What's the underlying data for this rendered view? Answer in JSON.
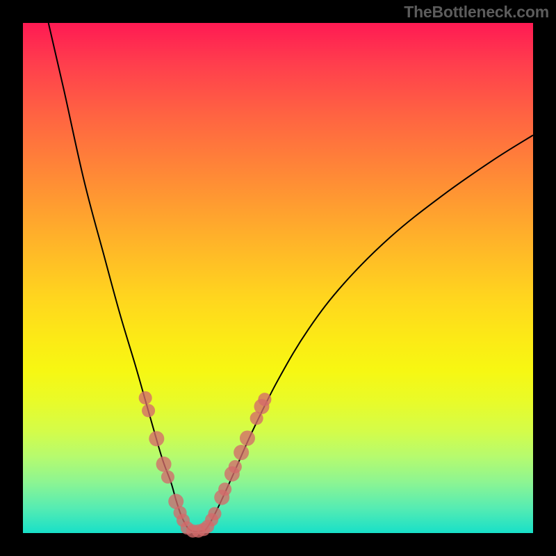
{
  "watermark": "TheBottleneck.com",
  "colors": {
    "dot": "#d46a6a",
    "curve": "#000000",
    "plot_top": "#ff1a53",
    "plot_bottom": "#18e0c8",
    "frame": "#000000"
  },
  "chart_data": {
    "type": "line",
    "title": "",
    "xlabel": "",
    "ylabel": "",
    "xlim": [
      0,
      100
    ],
    "ylim": [
      0,
      100
    ],
    "series": [
      {
        "name": "left-branch",
        "x": [
          5,
          8,
          12,
          16,
          19,
          22,
          24,
          26,
          27.5,
          29,
          30,
          31,
          31.8
        ],
        "y": [
          100,
          87,
          69,
          54,
          43,
          33,
          26,
          19,
          14,
          10,
          6.5,
          3.5,
          1.8
        ]
      },
      {
        "name": "valley",
        "x": [
          31.8,
          32.5,
          33.2,
          34,
          35,
          36
        ],
        "y": [
          1.8,
          0.8,
          0.4,
          0.25,
          0.4,
          0.9
        ]
      },
      {
        "name": "right-branch",
        "x": [
          36,
          38,
          41,
          45,
          50,
          56,
          63,
          72,
          82,
          92,
          100
        ],
        "y": [
          0.9,
          4.5,
          11,
          20,
          30,
          40,
          49,
          58,
          66,
          73,
          78
        ]
      }
    ],
    "dots": {
      "name": "highlight-dots",
      "points": [
        {
          "x": 24.0,
          "y": 26.5,
          "r": 1.3
        },
        {
          "x": 24.6,
          "y": 24.0,
          "r": 1.3
        },
        {
          "x": 26.2,
          "y": 18.5,
          "r": 1.5
        },
        {
          "x": 27.6,
          "y": 13.5,
          "r": 1.5
        },
        {
          "x": 28.4,
          "y": 11.0,
          "r": 1.3
        },
        {
          "x": 30.0,
          "y": 6.2,
          "r": 1.5
        },
        {
          "x": 30.8,
          "y": 4.0,
          "r": 1.3
        },
        {
          "x": 31.4,
          "y": 2.5,
          "r": 1.3
        },
        {
          "x": 32.2,
          "y": 1.0,
          "r": 1.3
        },
        {
          "x": 33.3,
          "y": 0.4,
          "r": 1.3
        },
        {
          "x": 34.4,
          "y": 0.4,
          "r": 1.3
        },
        {
          "x": 35.4,
          "y": 0.7,
          "r": 1.3
        },
        {
          "x": 36.2,
          "y": 1.3,
          "r": 1.3
        },
        {
          "x": 37.0,
          "y": 2.6,
          "r": 1.3
        },
        {
          "x": 37.6,
          "y": 3.8,
          "r": 1.3
        },
        {
          "x": 39.0,
          "y": 7.0,
          "r": 1.5
        },
        {
          "x": 39.6,
          "y": 8.6,
          "r": 1.3
        },
        {
          "x": 41.0,
          "y": 11.6,
          "r": 1.5
        },
        {
          "x": 41.6,
          "y": 13.0,
          "r": 1.3
        },
        {
          "x": 42.8,
          "y": 15.8,
          "r": 1.5
        },
        {
          "x": 44.0,
          "y": 18.6,
          "r": 1.5
        },
        {
          "x": 45.8,
          "y": 22.5,
          "r": 1.3
        },
        {
          "x": 46.8,
          "y": 24.8,
          "r": 1.5
        },
        {
          "x": 47.4,
          "y": 26.2,
          "r": 1.3
        }
      ]
    }
  }
}
